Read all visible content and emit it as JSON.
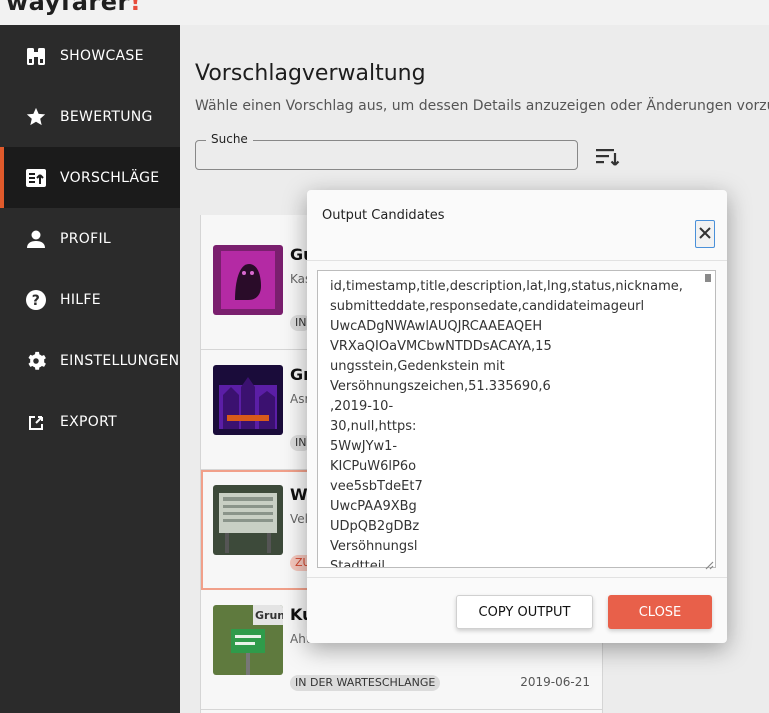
{
  "app": {
    "logo_text": "wayfarer",
    "logo_mark": "!"
  },
  "sidebar": {
    "items": [
      {
        "label": "SHOWCASE",
        "icon": "binoculars-icon",
        "active": false
      },
      {
        "label": "BEWERTUNG",
        "icon": "star-icon",
        "active": false
      },
      {
        "label": "VORSCHLÄGE",
        "icon": "upload-list-icon",
        "active": true
      },
      {
        "label": "PROFIL",
        "icon": "person-icon",
        "active": false
      },
      {
        "label": "HILFE",
        "icon": "help-icon",
        "active": false
      },
      {
        "label": "EINSTELLUNGEN",
        "icon": "gear-icon",
        "active": false
      },
      {
        "label": "EXPORT",
        "icon": "export-icon",
        "active": false
      }
    ]
  },
  "main": {
    "title": "Vorschlagverwaltung",
    "subtitle": "Wähle einen Vorschlag aus, um dessen Details anzuzeigen oder Änderungen vorzune",
    "search": {
      "label": "Suche",
      "value": ""
    }
  },
  "list": {
    "items": [
      {
        "title": "Gu",
        "location": "Kas",
        "badge": "IN",
        "badge_style": "grey",
        "date": ""
      },
      {
        "title": "Gr",
        "location": "Asr",
        "badge": "IN",
        "badge_style": "grey",
        "date": ""
      },
      {
        "title": "Wa",
        "location": "Vel",
        "badge": "ZU",
        "badge_style": "red",
        "date": ""
      },
      {
        "title": "Ku",
        "location": "Ahu",
        "badge": "IN DER WARTESCHLANGE",
        "badge_style": "grey",
        "date": "2019-06-21"
      }
    ]
  },
  "dialog": {
    "title": "Output Candidates",
    "output_lines_full": "id,timestamp,title,description,lat,lng,status,nickname,\nsubmitteddate,responsedate,candidateimageurl",
    "output_lines_partial": "UwcADgNWAwlAUQJRCAAEAQEH\nVRXaQIOaVMCbwNTDDsACAYA,15\nungsstein,Gedenkstein mit\nVersöhnungszeichen,51.335690,6\n,2019-10-\n30,null,https:\n5WwJYw1-\nKICPuW6lP6o\nvee5sbTdeEt7\nUwcPAA9XBg\nUDpQB2gDBz\nVersöhnungsl\nStadtteil",
    "copy_label": "COPY OUTPUT",
    "close_label": "CLOSE"
  },
  "colors": {
    "accent": "#e05a2b",
    "close_button": "#e8604a",
    "sidebar_bg": "#2b2b2b"
  }
}
